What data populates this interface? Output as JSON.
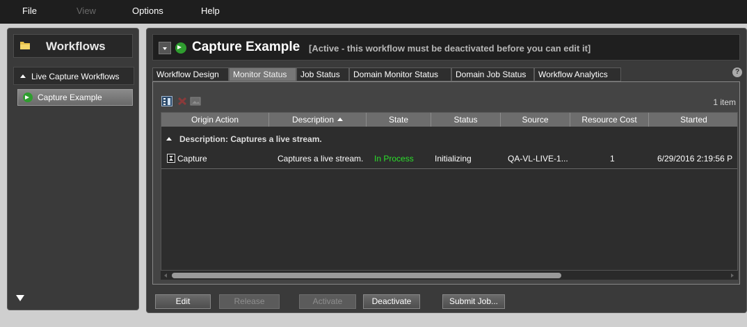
{
  "menu": {
    "file": "File",
    "view": "View",
    "options": "Options",
    "help": "Help"
  },
  "sidebar": {
    "title": "Workflows",
    "group_label": "Live Capture Workflows",
    "items": [
      {
        "label": "Capture Example"
      }
    ]
  },
  "header": {
    "title": "Capture Example",
    "note": "[Active - this workflow must be deactivated before you can edit it]",
    "help": "?"
  },
  "tabs": [
    {
      "label": "Workflow Design",
      "active": false
    },
    {
      "label": "Monitor Status",
      "active": true
    },
    {
      "label": "Job Status",
      "active": false
    },
    {
      "label": "Domain Monitor Status",
      "active": false
    },
    {
      "label": "Domain Job Status",
      "active": false
    },
    {
      "label": "Workflow Analytics",
      "active": false
    }
  ],
  "toolbar": {
    "item_count": "1 item"
  },
  "table": {
    "columns": [
      "Origin Action",
      "Description",
      "State",
      "Status",
      "Source",
      "Resource Cost",
      "Started"
    ],
    "sort_column": "Description",
    "group_label": "Description: Captures a live stream.",
    "rows": [
      {
        "origin_action": "Capture",
        "description": "Captures a live stream.",
        "state": "In Process",
        "status": "Initializing",
        "source": "QA-VL-LIVE-1...",
        "resource_cost": "1",
        "started": "6/29/2016 2:19:56 P"
      }
    ]
  },
  "buttons": {
    "edit": "Edit",
    "release": "Release",
    "activate": "Activate",
    "deactivate": "Deactivate",
    "submit_job": "Submit Job..."
  },
  "colors": {
    "state_green": "#2be02b",
    "go_green": "#2f9d2f",
    "active_tab": "#777777"
  }
}
